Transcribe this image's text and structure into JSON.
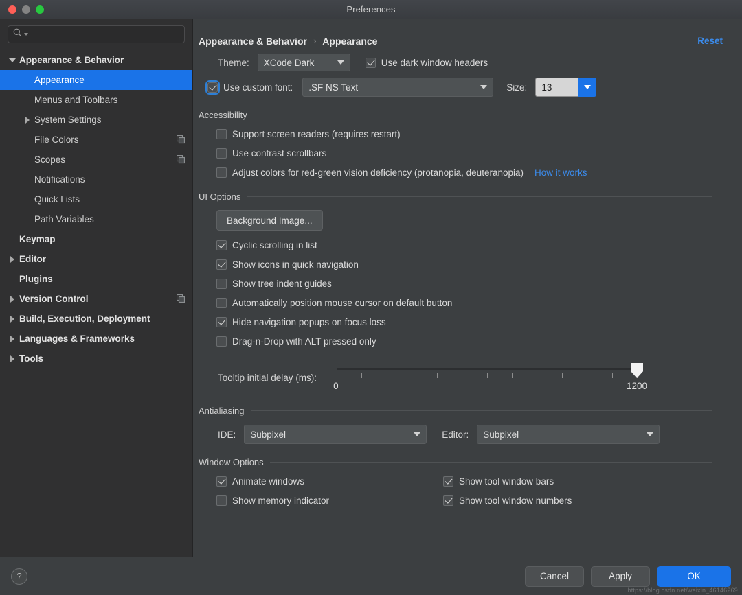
{
  "window": {
    "title": "Preferences",
    "traffic_lights": [
      "close-red",
      "minimize-amber",
      "zoom-green"
    ]
  },
  "search": {
    "value": "",
    "placeholder": ""
  },
  "sidebar": {
    "items": [
      {
        "label": "Appearance & Behavior",
        "indent": 0,
        "arrow": "down",
        "bold": true,
        "selected": false,
        "copy": false
      },
      {
        "label": "Appearance",
        "indent": 1,
        "arrow": "none",
        "bold": false,
        "selected": true,
        "copy": false
      },
      {
        "label": "Menus and Toolbars",
        "indent": 1,
        "arrow": "none",
        "bold": false,
        "selected": false,
        "copy": false
      },
      {
        "label": "System Settings",
        "indent": 1,
        "arrow": "right",
        "bold": false,
        "selected": false,
        "copy": false
      },
      {
        "label": "File Colors",
        "indent": 1,
        "arrow": "none",
        "bold": false,
        "selected": false,
        "copy": true
      },
      {
        "label": "Scopes",
        "indent": 1,
        "arrow": "none",
        "bold": false,
        "selected": false,
        "copy": true
      },
      {
        "label": "Notifications",
        "indent": 1,
        "arrow": "none",
        "bold": false,
        "selected": false,
        "copy": false
      },
      {
        "label": "Quick Lists",
        "indent": 1,
        "arrow": "none",
        "bold": false,
        "selected": false,
        "copy": false
      },
      {
        "label": "Path Variables",
        "indent": 1,
        "arrow": "none",
        "bold": false,
        "selected": false,
        "copy": false
      },
      {
        "label": "Keymap",
        "indent": 0,
        "arrow": "none",
        "bold": true,
        "selected": false,
        "copy": false
      },
      {
        "label": "Editor",
        "indent": 0,
        "arrow": "right",
        "bold": true,
        "selected": false,
        "copy": false
      },
      {
        "label": "Plugins",
        "indent": 0,
        "arrow": "none",
        "bold": true,
        "selected": false,
        "copy": false
      },
      {
        "label": "Version Control",
        "indent": 0,
        "arrow": "right",
        "bold": true,
        "selected": false,
        "copy": true
      },
      {
        "label": "Build, Execution, Deployment",
        "indent": 0,
        "arrow": "right",
        "bold": true,
        "selected": false,
        "copy": false
      },
      {
        "label": "Languages & Frameworks",
        "indent": 0,
        "arrow": "right",
        "bold": true,
        "selected": false,
        "copy": false
      },
      {
        "label": "Tools",
        "indent": 0,
        "arrow": "right",
        "bold": true,
        "selected": false,
        "copy": false
      }
    ]
  },
  "main": {
    "breadcrumb": {
      "parent": "Appearance & Behavior",
      "separator": "›",
      "current": "Appearance"
    },
    "reset_label": "Reset",
    "theme": {
      "label": "Theme:",
      "value": "XCode Dark",
      "dark_headers": {
        "label": "Use dark window headers",
        "checked": true
      }
    },
    "font": {
      "use_custom": {
        "label": "Use custom font:",
        "checked": true,
        "focused": true
      },
      "family": ".SF NS Text",
      "size_label": "Size:",
      "size_value": "13"
    },
    "accessibility": {
      "title": "Accessibility",
      "items": [
        {
          "label": "Support screen readers (requires restart)",
          "checked": false
        },
        {
          "label": "Use contrast scrollbars",
          "checked": false
        },
        {
          "label": "Adjust colors for red-green vision deficiency (protanopia, deuteranopia)",
          "checked": false,
          "link": "How it works"
        }
      ]
    },
    "ui_options": {
      "title": "UI Options",
      "background_image_button": "Background Image...",
      "items": [
        {
          "label": "Cyclic scrolling in list",
          "checked": true
        },
        {
          "label": "Show icons in quick navigation",
          "checked": true
        },
        {
          "label": "Show tree indent guides",
          "checked": false
        },
        {
          "label": "Automatically position mouse cursor on default button",
          "checked": false
        },
        {
          "label": "Hide navigation popups on focus loss",
          "checked": true
        },
        {
          "label": "Drag-n-Drop with ALT pressed only",
          "checked": false
        }
      ]
    },
    "tooltip_delay": {
      "label": "Tooltip initial delay (ms):",
      "min_label": "0",
      "max_label": "1200",
      "value": 1200,
      "ticks": 13
    },
    "antialiasing": {
      "title": "Antialiasing",
      "ide_label": "IDE:",
      "ide_value": "Subpixel",
      "editor_label": "Editor:",
      "editor_value": "Subpixel"
    },
    "window_options": {
      "title": "Window Options",
      "left": [
        {
          "label": "Animate windows",
          "checked": true
        },
        {
          "label": "Show memory indicator",
          "checked": false
        }
      ],
      "right": [
        {
          "label": "Show tool window bars",
          "checked": true
        },
        {
          "label": "Show tool window numbers",
          "checked": true
        }
      ]
    }
  },
  "footer": {
    "help_label": "?",
    "cancel_label": "Cancel",
    "apply_label": "Apply",
    "ok_label": "OK",
    "watermark": "https://blog.csdn.net/weixin_46146269"
  },
  "colors": {
    "accent_blue": "#1a73e8",
    "link_blue": "#3b8beb",
    "panel_bg": "#3c3f41",
    "sidebar_bg": "#303031"
  }
}
